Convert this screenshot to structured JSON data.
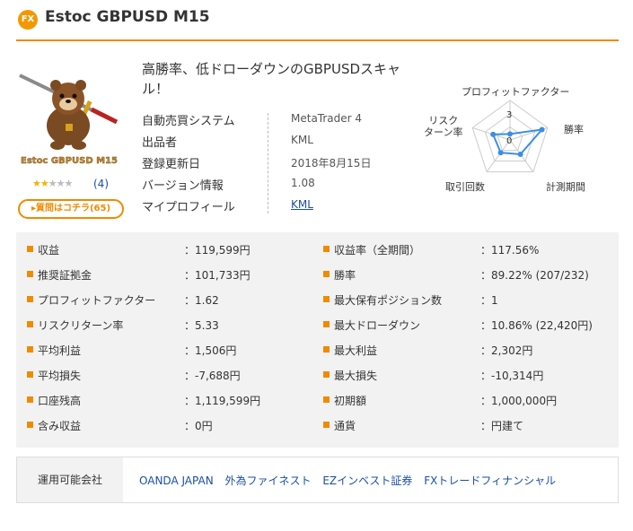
{
  "header": {
    "badge": "FX",
    "title": "Estoc GBPUSD M15"
  },
  "product": {
    "image_caption": "Estoc GBPUSD M15",
    "rating_stars": 2,
    "rating_max": 5,
    "rating_count": "(4)",
    "qa_button": "質問はコチラ(65)"
  },
  "headline": "高勝率、低ドローダウンのGBPUSDスキャル！",
  "info": [
    {
      "label": "自動売買システム",
      "value": "MetaTrader 4"
    },
    {
      "label": "出品者",
      "value": "KML"
    },
    {
      "label": "登録更新日",
      "value": "2018年8月15日"
    },
    {
      "label": "バージョン情報",
      "value": "1.08"
    },
    {
      "label": "マイプロフィール",
      "value": "KML"
    }
  ],
  "radar": {
    "labels": {
      "top": "プロフィットファクター",
      "right": "勝率",
      "bottom_right": "計測期間",
      "bottom_left": "取引回数",
      "left": "リスク\nターン率"
    },
    "scale_max_label": "3",
    "scale_zero_label": "0",
    "values_fraction": [
      0.15,
      0.85,
      0.45,
      0.4,
      0.45
    ],
    "color": "#3a8ee6"
  },
  "stats": {
    "left": [
      {
        "label": "収益",
        "value": "：119,599円"
      },
      {
        "label": "推奨証拠金",
        "value": "：101,733円"
      },
      {
        "label": "プロフィットファクター",
        "value": "：1.62"
      },
      {
        "label": "リスクリターン率",
        "value": "：5.33"
      },
      {
        "label": "平均利益",
        "value": "：1,506円"
      },
      {
        "label": "平均損失",
        "value": "：-7,688円"
      },
      {
        "label": "口座残高",
        "value": "：1,119,599円"
      },
      {
        "label": "含み収益",
        "value": "：0円"
      }
    ],
    "right": [
      {
        "label": "収益率（全期間）",
        "value": "：117.56%"
      },
      {
        "label": "勝率",
        "value": "：89.22% (207/232)"
      },
      {
        "label": "最大保有ポジション数",
        "value": "：1"
      },
      {
        "label": "最大ドローダウン",
        "value": "：10.86% (22,420円)"
      },
      {
        "label": "最大利益",
        "value": "：2,302円"
      },
      {
        "label": "最大損失",
        "value": "：-10,314円"
      },
      {
        "label": "初期額",
        "value": "：1,000,000円"
      },
      {
        "label": "通貨",
        "value": "：円建て"
      }
    ]
  },
  "brokers": {
    "heading": "運用可能会社",
    "items": [
      "OANDA JAPAN",
      "外為ファイネスト",
      "EZインベスト証券",
      "FXトレードフィナンシャル"
    ]
  },
  "colors": {
    "accent": "#f08a00",
    "link": "#1a4ea8",
    "panel": "#f2f2f2"
  }
}
